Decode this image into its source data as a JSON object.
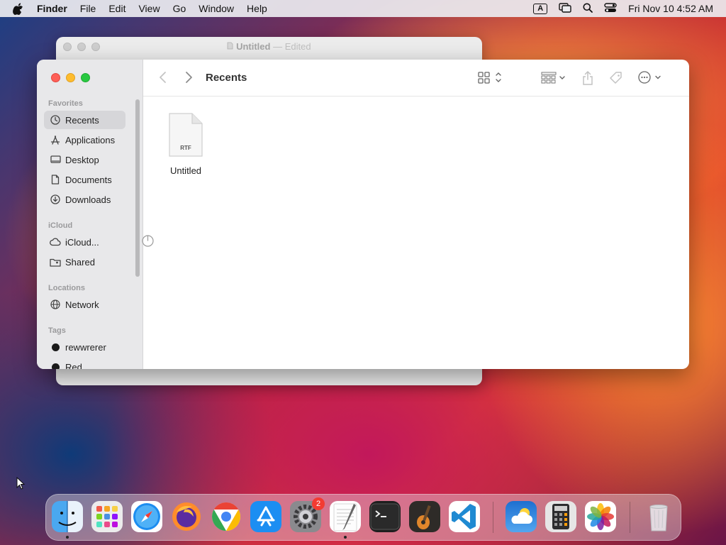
{
  "menubar": {
    "app_name": "Finder",
    "items": [
      "File",
      "Edit",
      "View",
      "Go",
      "Window",
      "Help"
    ],
    "input_badge": "A",
    "clock": "Fri Nov 10  4:52 AM"
  },
  "background_window": {
    "title": "Untitled",
    "title_suffix": "— Edited"
  },
  "finder": {
    "title": "Recents",
    "sidebar": {
      "favorites_label": "Favorites",
      "favorites": [
        "Recents",
        "Applications",
        "Desktop",
        "Documents",
        "Downloads"
      ],
      "icloud_label": "iCloud",
      "icloud": [
        "iCloud...",
        "Shared"
      ],
      "locations_label": "Locations",
      "locations": [
        "Network"
      ],
      "tags_label": "Tags",
      "tags": [
        "rewwrerer",
        "Red"
      ]
    },
    "files": [
      {
        "name": "Untitled",
        "type": "RTF"
      }
    ]
  },
  "dock": {
    "settings_badge": "2",
    "apps": [
      "finder",
      "launchpad",
      "safari",
      "firefox",
      "chrome",
      "app-store",
      "system-settings",
      "textedit",
      "terminal",
      "garageband",
      "vscode",
      "weather",
      "calculator",
      "photos",
      "trash"
    ]
  },
  "colors": {
    "close": "#fe5f57",
    "minimize": "#febc2e",
    "maximize": "#28c840",
    "badge": "#f33b32"
  }
}
